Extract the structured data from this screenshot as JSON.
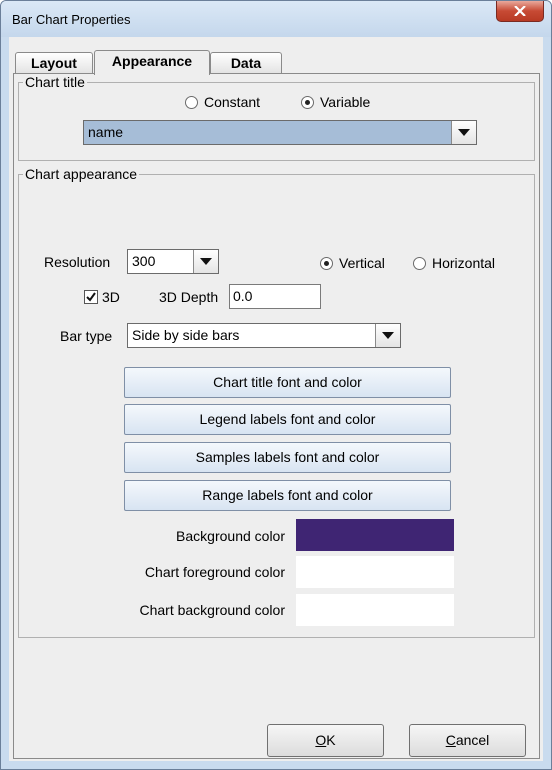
{
  "window": {
    "title": "Bar Chart Properties"
  },
  "tabs": [
    {
      "label": "Layout",
      "active": false
    },
    {
      "label": "Appearance",
      "active": true
    },
    {
      "label": "Data",
      "active": false
    }
  ],
  "chart_title": {
    "legend": "Chart title",
    "option_constant": "Constant",
    "option_variable": "Variable",
    "selected_option": "Variable",
    "value": "name"
  },
  "chart_appearance": {
    "legend": "Chart appearance",
    "resolution_label": "Resolution",
    "resolution_value": "300",
    "orientation_vertical": "Vertical",
    "orientation_horizontal": "Horizontal",
    "selected_orientation": "Vertical",
    "three_d_label": "3D",
    "three_d_checked": true,
    "depth_label": "3D Depth",
    "depth_value": "0.0",
    "bar_type_label": "Bar type",
    "bar_type_value": "Side by side bars",
    "buttons": {
      "chart_title_font": "Chart title font and color",
      "legend_labels_font": "Legend labels font and color",
      "samples_labels_font": "Samples labels font and color",
      "range_labels_font": "Range labels font and color"
    },
    "colors": {
      "background_label": "Background color",
      "background_value": "#3f2573",
      "chart_foreground_label": "Chart foreground color",
      "chart_foreground_value": "#ffffff",
      "chart_background_label": "Chart background color",
      "chart_background_value": "#ffffff"
    }
  },
  "footer": {
    "ok_mnemonic": "O",
    "ok_rest": "K",
    "cancel_mnemonic": "C",
    "cancel_rest": "ancel"
  }
}
